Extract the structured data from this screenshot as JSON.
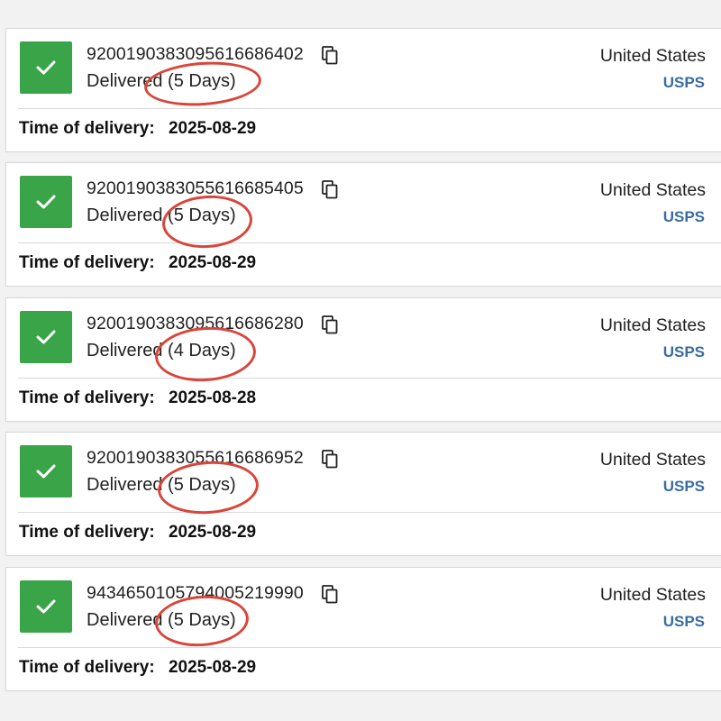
{
  "colors": {
    "check_bg": "#3aa548",
    "carrier_link": "#3a6da3",
    "annotation_circle": "#d9453a"
  },
  "icons": {
    "status": "check-icon",
    "copy": "copy-icon"
  },
  "delivery_label": "Time of delivery:",
  "shipments": [
    {
      "tracking": "92001903830956166864 02",
      "status_prefix": "Delivere",
      "status_suffix": "d (5 Days)",
      "country": "United States",
      "carrier": "USPS",
      "delivery_date": "2025-08-29"
    },
    {
      "tracking": "92001903830556166854 05",
      "status_prefix": "Delivere",
      "status_suffix": "d (5 Days)",
      "country": "United States",
      "carrier": "USPS",
      "delivery_date": "2025-08-29"
    },
    {
      "tracking": "92001903830956166862 80",
      "status_prefix": "Delivere",
      "status_suffix": "d (4 Days)",
      "country": "United States",
      "carrier": "USPS",
      "delivery_date": "2025-08-28"
    },
    {
      "tracking": "92001903830556166869 52",
      "status_prefix": "Delivere",
      "status_suffix": "d (5 Days)",
      "country": "United States",
      "carrier": "USPS",
      "delivery_date": "2025-08-29"
    },
    {
      "tracking": "94346501057940052199 90",
      "status_prefix": "Delivere",
      "status_suffix": "d (5 Days)",
      "country": "United States",
      "carrier": "USPS",
      "delivery_date": "2025-08-29"
    }
  ]
}
